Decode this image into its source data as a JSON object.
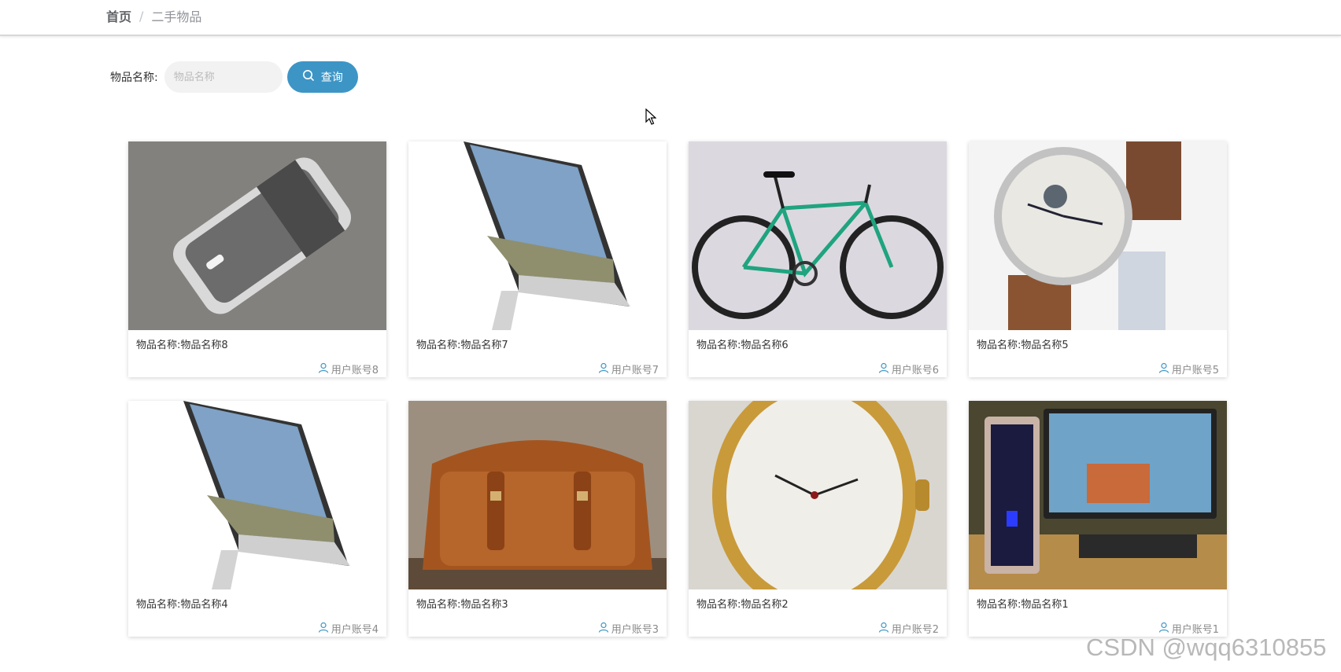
{
  "breadcrumb": {
    "home": "首页",
    "separator": "/",
    "current": "二手物品"
  },
  "search": {
    "label": "物品名称:",
    "placeholder": "物品名称",
    "value": "",
    "button_label": "查询"
  },
  "accent_color": "#3d95c6",
  "items": [
    {
      "name": "物品名称:物品名称8",
      "user": "用户账号8",
      "image": "nokia-phone"
    },
    {
      "name": "物品名称:物品名称7",
      "user": "用户账号7",
      "image": "imac"
    },
    {
      "name": "物品名称:物品名称6",
      "user": "用户账号6",
      "image": "bicycle"
    },
    {
      "name": "物品名称:物品名称5",
      "user": "用户账号5",
      "image": "wristwatch"
    },
    {
      "name": "物品名称:物品名称4",
      "user": "用户账号4",
      "image": "imac"
    },
    {
      "name": "物品名称:物品名称3",
      "user": "用户账号3",
      "image": "leather-bag"
    },
    {
      "name": "物品名称:物品名称2",
      "user": "用户账号2",
      "image": "grimoldi-watch"
    },
    {
      "name": "物品名称:物品名称1",
      "user": "用户账号1",
      "image": "gaming-pc"
    }
  ],
  "watermark": "CSDN @wqq6310855"
}
